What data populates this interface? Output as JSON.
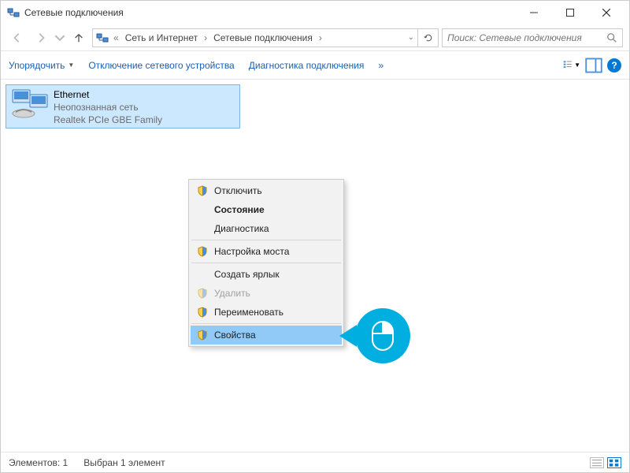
{
  "titlebar": {
    "title": "Сетевые подключения"
  },
  "nav": {
    "breadcrumb_prefix": "«",
    "seg1": "Сеть и Интернет",
    "seg2": "Сетевые подключения",
    "search_placeholder": "Поиск: Сетевые подключения"
  },
  "cmd": {
    "organize": "Упорядочить",
    "disable": "Отключение сетевого устройства",
    "diagnose": "Диагностика подключения",
    "more": "»"
  },
  "nic": {
    "name": "Ethernet",
    "status": "Неопознанная сеть",
    "device": "Realtek PCIe GBE Family"
  },
  "ctx": {
    "disable": "Отключить",
    "state": "Состояние",
    "diagnostics": "Диагностика",
    "bridge": "Настройка моста",
    "shortcut": "Создать ярлык",
    "delete": "Удалить",
    "rename": "Переименовать",
    "properties": "Свойства"
  },
  "status": {
    "count": "Элементов: 1",
    "selected": "Выбран 1 элемент"
  }
}
